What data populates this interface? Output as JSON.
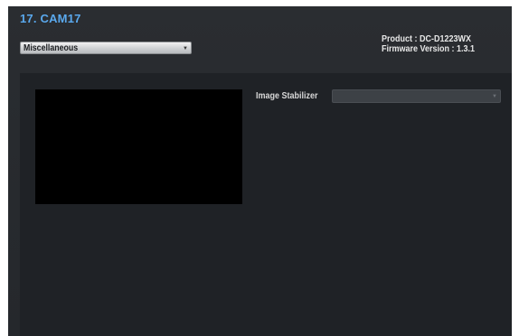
{
  "header": {
    "camera_title": "17. CAM17"
  },
  "category_select": {
    "selected": "Miscellaneous",
    "arrow_icon": "chevron-down-icon"
  },
  "product_info": {
    "product_line": "Product : DC-D1223WX",
    "firmware_line": "Firmware Version : 1.3.1"
  },
  "settings": {
    "image_stabilizer": {
      "label": "Image Stabilizer",
      "value": "",
      "arrow_icon": "chevron-down-icon"
    }
  },
  "colors": {
    "title_accent": "#5aa9ee",
    "window_bg": "#2a2d31",
    "panel_bg": "#1f2226",
    "preview_bg": "#000000"
  }
}
